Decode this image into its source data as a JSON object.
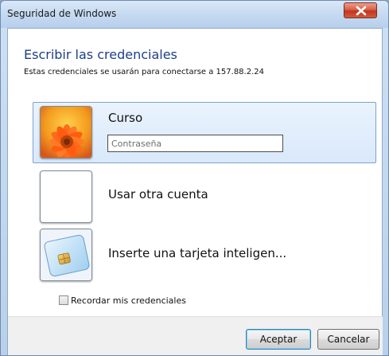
{
  "window": {
    "title": "Seguridad de Windows"
  },
  "header": {
    "heading": "Escribir las credenciales",
    "subheading": "Estas credenciales se usarán para conectarse a 157.88.2.24"
  },
  "accounts": [
    {
      "label": "Curso",
      "icon": "flower-user-picture-icon"
    },
    {
      "label": "Usar otra cuenta",
      "icon": "blank-user-picture-icon"
    },
    {
      "label": "Inserte una tarjeta inteligen...",
      "icon": "smart-card-icon"
    }
  ],
  "password": {
    "placeholder": "Contraseña",
    "value": ""
  },
  "remember": {
    "label": "Recordar mis credenciales",
    "checked": false
  },
  "buttons": {
    "ok": "Aceptar",
    "cancel": "Cancelar"
  },
  "colors": {
    "heading": "#1e3d8a",
    "selection": "#d9e9fb",
    "close": "#c2341f"
  }
}
